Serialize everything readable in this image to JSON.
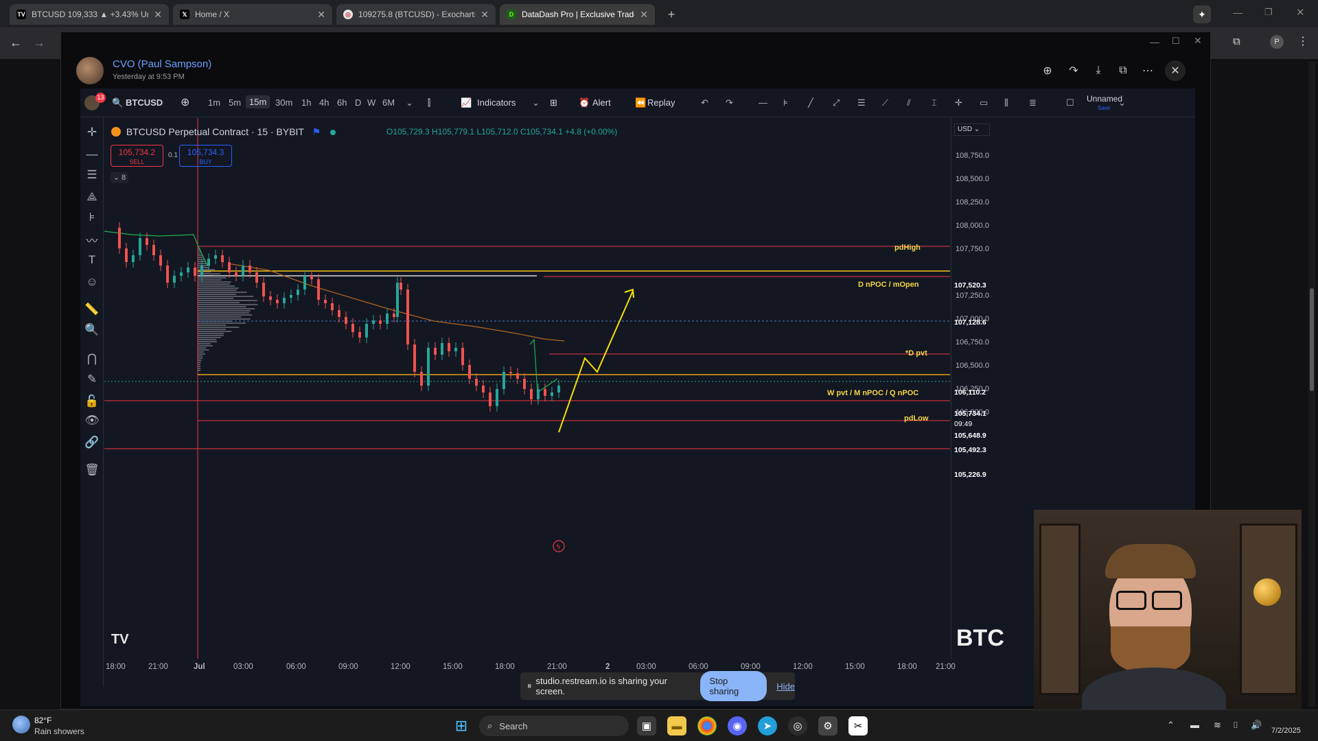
{
  "browser": {
    "tabs": [
      {
        "title": "BTCUSD 109,333 ▲ +3.43% Un",
        "favicon": "TV",
        "active": false
      },
      {
        "title": "Home / X",
        "favicon": "X",
        "active": false
      },
      {
        "title": "109275.8 (BTCUSD) - Exocharts",
        "favicon": "E",
        "active": false
      },
      {
        "title": "DataDash Pro | Exclusive Trader",
        "favicon": "D",
        "active": true
      }
    ]
  },
  "post": {
    "author": "CVO (Paul Sampson)",
    "time": "Yesterday at 9:53 PM"
  },
  "tv": {
    "symbol": "BTCUSD",
    "timeframes": [
      "1m",
      "5m",
      "15m",
      "30m",
      "1h",
      "4h",
      "6h",
      "D",
      "W",
      "6M"
    ],
    "selected_timeframe": "15m",
    "indicators_label": "Indicators",
    "alert_label": "Alert",
    "replay_label": "Replay",
    "layout_name": "Unnamed",
    "layout_sub": "Save",
    "currency": "USD",
    "notif_count": "13",
    "symbol_line": "BTCUSD Perpetual Contract · 15 · BYBIT",
    "ohlc": "O105,729.3 H105,779.1 L105,712.0 C105,734.1 +4.8 (+0.00%)",
    "sell_price": "105,734.2",
    "sell_label": "SELL",
    "spread": "0.1",
    "buy_price": "105,734.3",
    "buy_label": "BUY",
    "indicator_count": "8",
    "y_labels": [
      "108,750.0",
      "108,500.0",
      "108,250.0",
      "108,000.0",
      "107,750.0",
      "107,250.0",
      "107,000.0",
      "106,750.0",
      "106,500.0",
      "106,250.0",
      "106,000.0"
    ],
    "price_tags": [
      {
        "text": "107,520.3",
        "color": "#f23645"
      },
      {
        "text": "107,128.6",
        "color": "#f23645"
      },
      {
        "text": "106,110.2",
        "color": "#f23645"
      },
      {
        "text": "105,734.1",
        "color": "#26a69a"
      },
      {
        "text": "09:49",
        "color": "#26a69a"
      },
      {
        "text": "105,648.9",
        "color": "#3a3e4a"
      },
      {
        "text": "105,492.3",
        "color": "#f23645"
      },
      {
        "text": "105,226.9",
        "color": "#f23645"
      }
    ],
    "levels": [
      "pdHigh",
      "D nPOC / mOpen",
      "*D pvt",
      "W pvt / M nPOC / Q nPOC",
      "pdLow"
    ],
    "x_labels": [
      "18:00",
      "21:00",
      "Jul",
      "03:00",
      "06:00",
      "09:00",
      "12:00",
      "15:00",
      "18:00",
      "21:00",
      "2",
      "03:00",
      "06:00",
      "09:00",
      "12:00",
      "15:00",
      "18:00",
      "21:00"
    ],
    "overlay_text": "BTC"
  },
  "share_bar": {
    "message": "studio.restream.io is sharing your screen.",
    "stop_label": "Stop sharing",
    "hide_label": "Hide"
  },
  "taskbar": {
    "weather_temp": "82°F",
    "weather_desc": "Rain showers",
    "search_label": "Search",
    "date": "7/2/2025"
  }
}
